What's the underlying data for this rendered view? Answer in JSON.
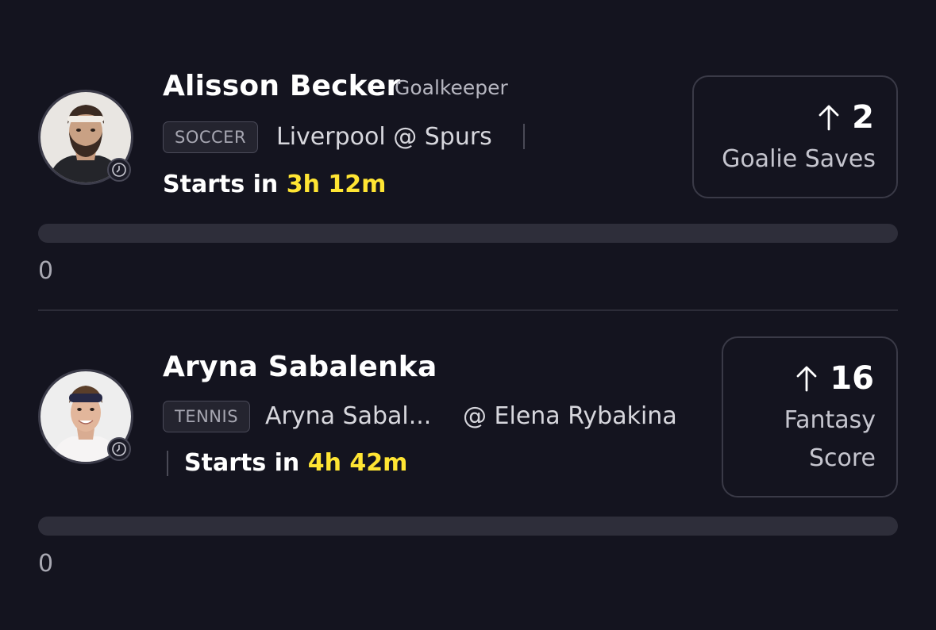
{
  "picks": [
    {
      "player_name": "Alisson Becker",
      "position": "Goalkeeper",
      "sport": "SOCCER",
      "matchup": "Liverpool @ Spurs",
      "starts_prefix": "Starts in ",
      "starts_time": "3h 12m",
      "stat_value": "2",
      "stat_label": "Goalie Saves",
      "progress_value": "0",
      "progress_fraction": 0,
      "avatar_icon": "player-photo-bearded-man"
    },
    {
      "player_name": "Aryna Sabalenka",
      "position": "",
      "sport": "TENNIS",
      "matchup_home": "Aryna Sabal...",
      "matchup_away": "@ Elena Rybakina",
      "starts_prefix": "Starts in ",
      "starts_time": "4h 42m",
      "stat_value": "16",
      "stat_label_line1": "Fantasy",
      "stat_label_line2": "Score",
      "progress_value": "0",
      "progress_fraction": 0,
      "avatar_icon": "player-photo-woman-headband"
    }
  ],
  "colors": {
    "background": "#14141f",
    "countdown": "#ffe533",
    "progress_track": "#2e2e3a"
  },
  "icons": {
    "clock": "clock-icon",
    "more": "arrow-up-icon"
  }
}
